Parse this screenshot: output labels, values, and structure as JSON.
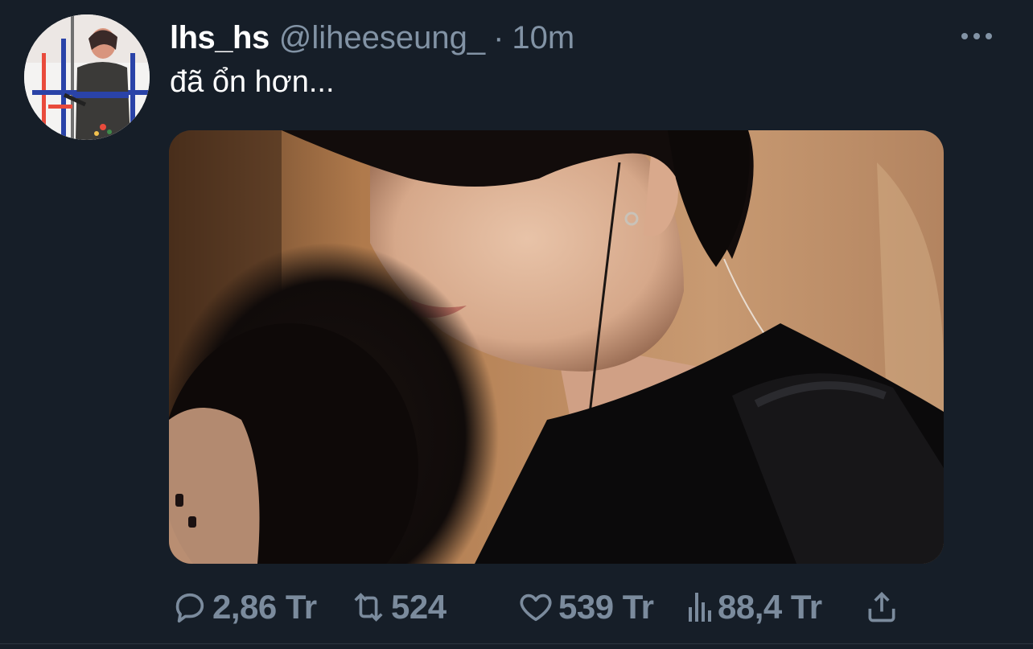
{
  "user": {
    "display_name": "lhs_hs",
    "handle": "@liheeseung_",
    "separator": "·",
    "time": "10m"
  },
  "tweet": {
    "text": "đã ổn hơn..."
  },
  "actions": {
    "reply_count": "2,86 Tr",
    "retweet_count": "524",
    "like_count": "539 Tr",
    "views_count": "88,4 Tr"
  },
  "icons": {
    "more": "more-options-icon",
    "reply": "reply-icon",
    "retweet": "retweet-icon",
    "like": "heart-icon",
    "views": "views-icon",
    "share": "share-icon"
  },
  "colors": {
    "background": "#161e28",
    "primary_text": "#ffffff",
    "secondary_text": "#8293a5",
    "action_icons": "#7b8b9d"
  }
}
